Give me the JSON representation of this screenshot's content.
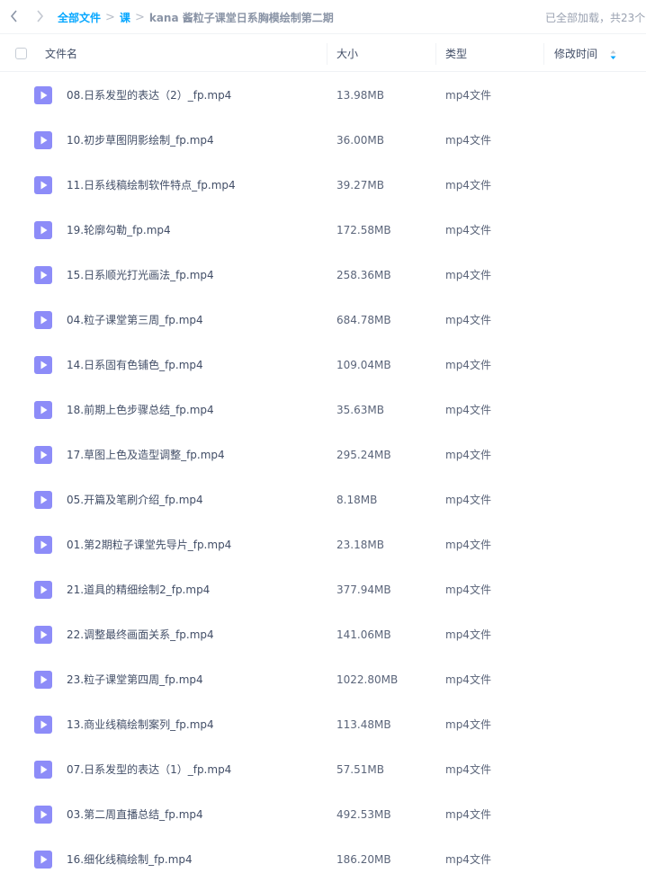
{
  "breadcrumb": {
    "root": "全部文件",
    "level1": "课",
    "current": "kana 酱粒子课堂日系胸模绘制第二期",
    "separator": ">"
  },
  "status": "已全部加载，共23个",
  "columns": {
    "name": "文件名",
    "size": "大小",
    "type": "类型",
    "modified": "修改时间"
  },
  "colors": {
    "accent": "#06a7ff",
    "video_icon": "#8d8cf8"
  },
  "files": [
    {
      "name": "08.日系发型的表达（2）_fp.mp4",
      "size": "13.98MB",
      "type": "mp4文件"
    },
    {
      "name": "10.初步草图阴影绘制_fp.mp4",
      "size": "36.00MB",
      "type": "mp4文件"
    },
    {
      "name": "11.日系线稿绘制软件特点_fp.mp4",
      "size": "39.27MB",
      "type": "mp4文件"
    },
    {
      "name": "19.轮廓勾勒_fp.mp4",
      "size": "172.58MB",
      "type": "mp4文件"
    },
    {
      "name": "15.日系顺光打光画法_fp.mp4",
      "size": "258.36MB",
      "type": "mp4文件"
    },
    {
      "name": "04.粒子课堂第三周_fp.mp4",
      "size": "684.78MB",
      "type": "mp4文件"
    },
    {
      "name": "14.日系固有色铺色_fp.mp4",
      "size": "109.04MB",
      "type": "mp4文件"
    },
    {
      "name": "18.前期上色步骤总结_fp.mp4",
      "size": "35.63MB",
      "type": "mp4文件"
    },
    {
      "name": "17.草图上色及造型调整_fp.mp4",
      "size": "295.24MB",
      "type": "mp4文件"
    },
    {
      "name": "05.开篇及笔刷介绍_fp.mp4",
      "size": "8.18MB",
      "type": "mp4文件"
    },
    {
      "name": "01.第2期粒子课堂先导片_fp.mp4",
      "size": "23.18MB",
      "type": "mp4文件"
    },
    {
      "name": "21.道具的精细绘制2_fp.mp4",
      "size": "377.94MB",
      "type": "mp4文件"
    },
    {
      "name": "22.调整最终画面关系_fp.mp4",
      "size": "141.06MB",
      "type": "mp4文件"
    },
    {
      "name": "23.粒子课堂第四周_fp.mp4",
      "size": "1022.80MB",
      "type": "mp4文件"
    },
    {
      "name": "13.商业线稿绘制案列_fp.mp4",
      "size": "113.48MB",
      "type": "mp4文件"
    },
    {
      "name": "07.日系发型的表达（1）_fp.mp4",
      "size": "57.51MB",
      "type": "mp4文件"
    },
    {
      "name": "03.第二周直播总结_fp.mp4",
      "size": "492.53MB",
      "type": "mp4文件"
    },
    {
      "name": "16.细化线稿绘制_fp.mp4",
      "size": "186.20MB",
      "type": "mp4文件"
    }
  ]
}
